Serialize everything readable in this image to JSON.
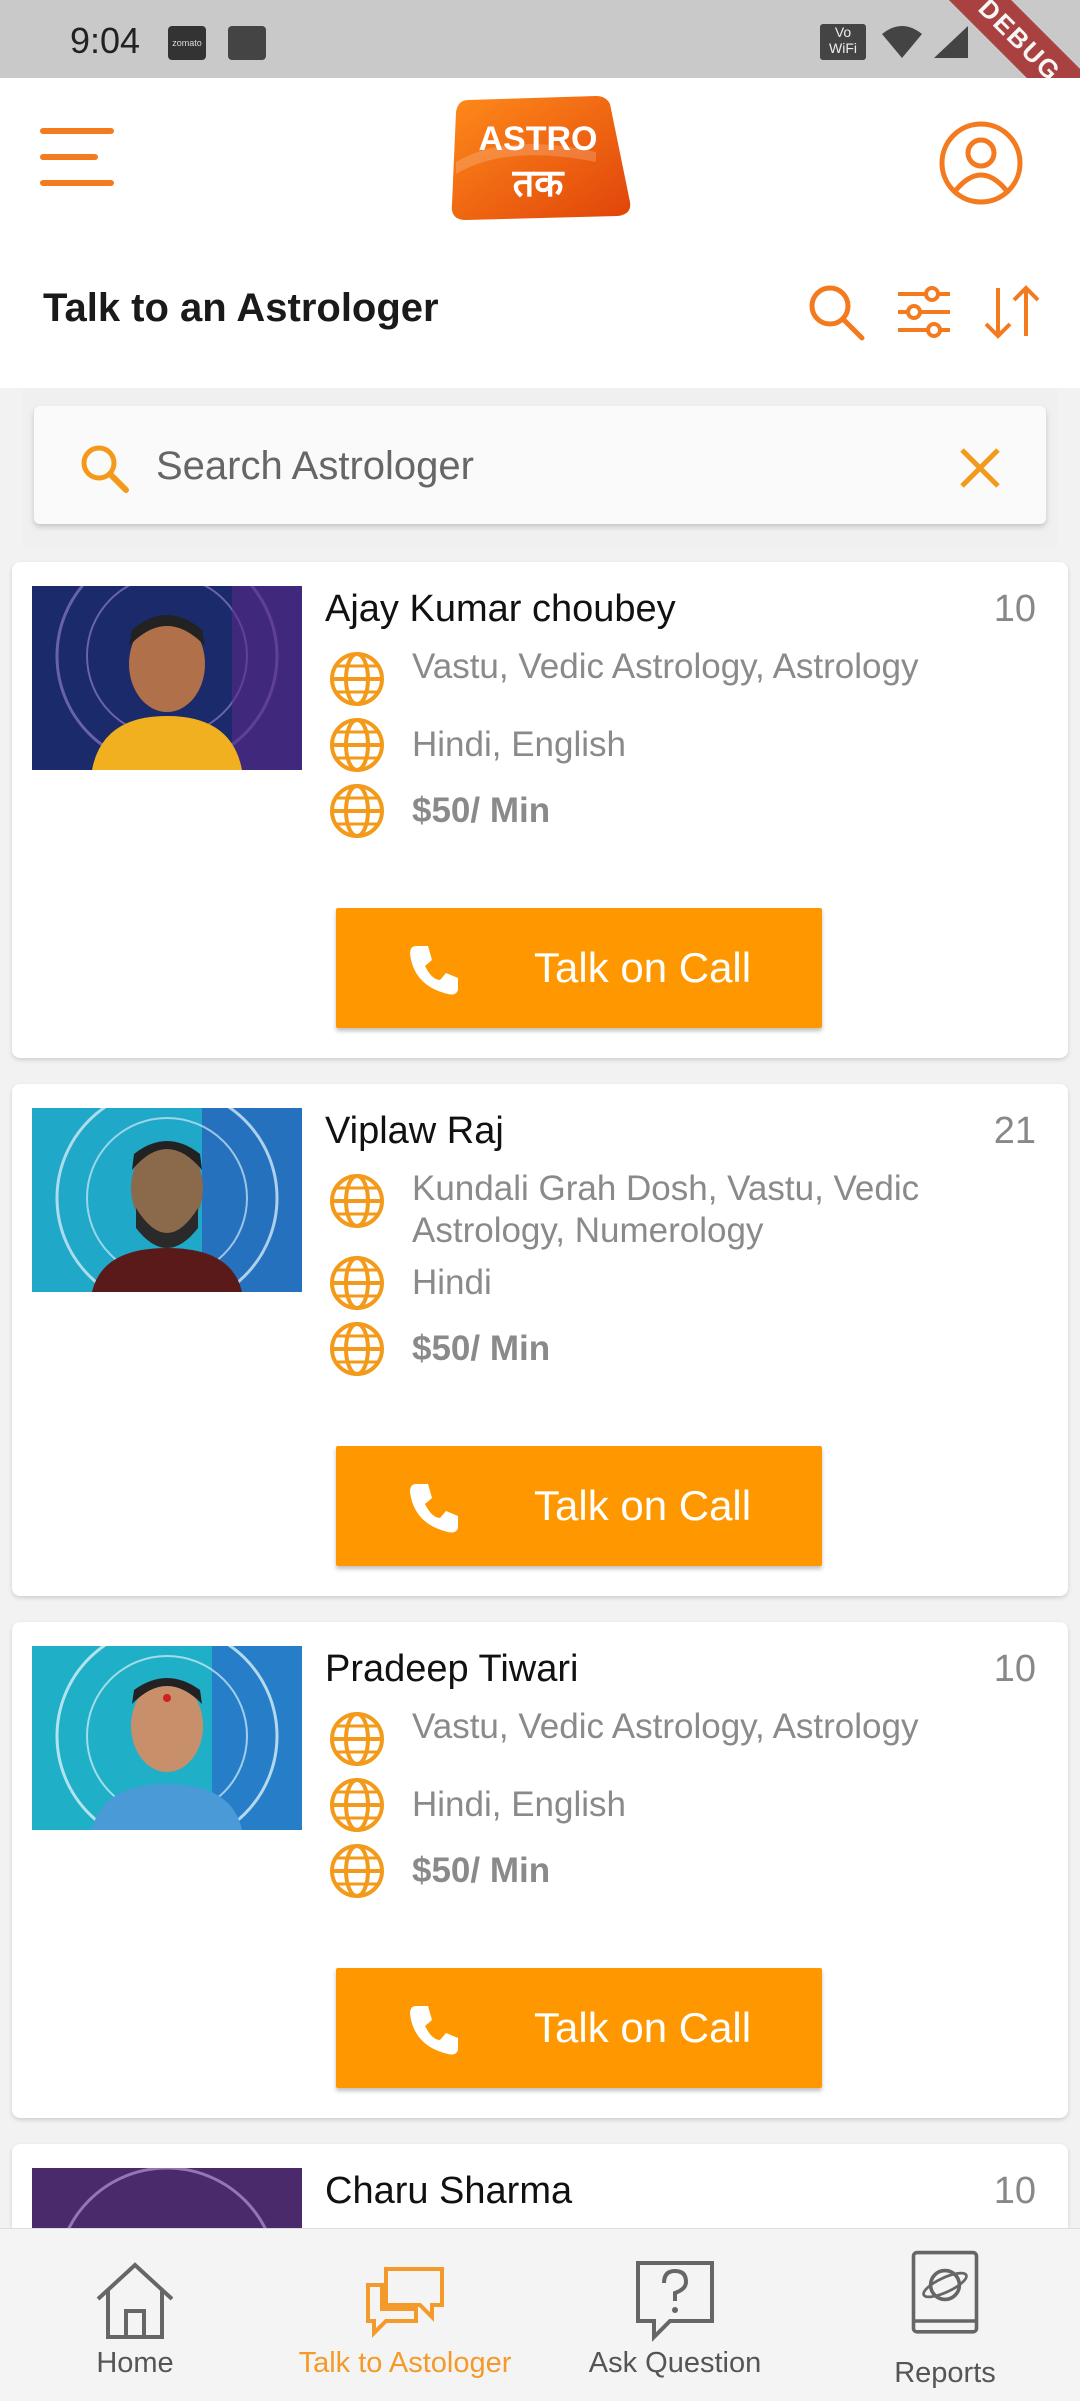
{
  "status_bar": {
    "time": "9:04",
    "debug_label": "DEBUG",
    "app_icon_text": "zomato",
    "wifi_label": "Vo WiFi"
  },
  "header": {
    "logo_top": "ASTRO",
    "logo_bottom": "तक"
  },
  "page": {
    "title": "Talk to an Astrologer"
  },
  "search": {
    "placeholder": "Search Astrologer",
    "value": ""
  },
  "colors": {
    "accent": "#ff9800",
    "icon_orange": "#f47a1f",
    "text_grey": "#8a8a8a"
  },
  "astrologers": [
    {
      "name": "Ajay Kumar choubey",
      "count": "10",
      "skills": "Vastu, Vedic Astrology, Astrology",
      "languages": "Hindi, English",
      "price": "$50/ Min",
      "button": "Talk on Call"
    },
    {
      "name": "Viplaw Raj",
      "count": "21",
      "skills": "Kundali Grah Dosh, Vastu, Vedic Astrology, Numerology",
      "languages": "Hindi",
      "price": "$50/ Min",
      "button": "Talk on Call"
    },
    {
      "name": "Pradeep Tiwari",
      "count": "10",
      "skills": "Vastu, Vedic Astrology, Astrology",
      "languages": "Hindi, English",
      "price": "$50/ Min",
      "button": "Talk on Call"
    },
    {
      "name": "Charu Sharma",
      "count": "10"
    }
  ],
  "bottom_nav": [
    {
      "label": "Home",
      "icon": "home-icon"
    },
    {
      "label": "Talk to Astologer",
      "icon": "chat-icon",
      "active": true
    },
    {
      "label": "Ask Question",
      "icon": "question-icon"
    },
    {
      "label": "Reports",
      "icon": "reports-icon"
    }
  ]
}
